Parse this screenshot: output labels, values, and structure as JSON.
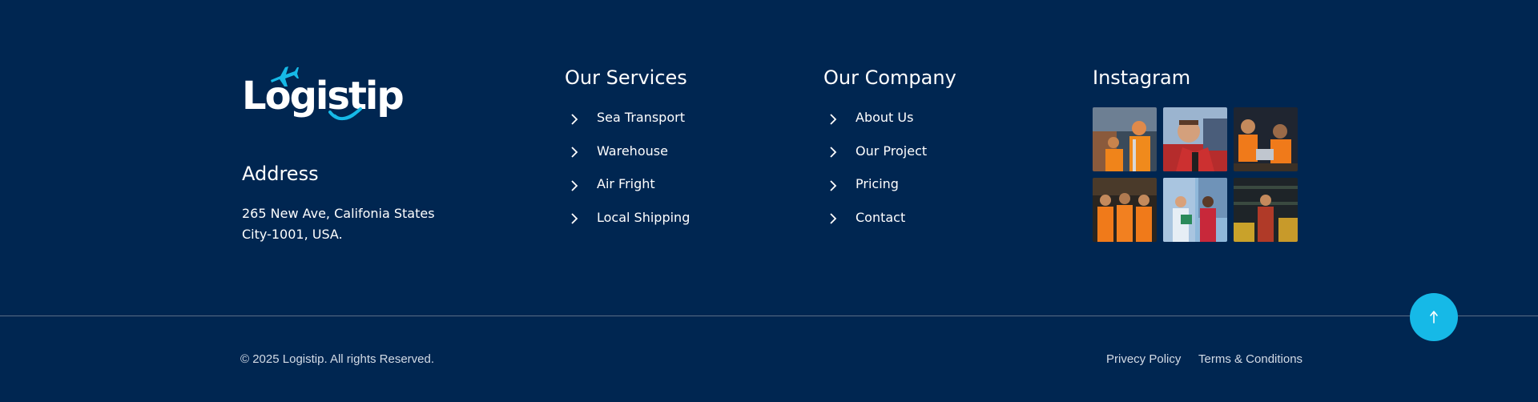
{
  "brand": {
    "name": "Logistip",
    "accent": "#16b9e7",
    "background": "#002651"
  },
  "address": {
    "title": "Address",
    "line1": "265 New Ave, Califonia States",
    "line2": "City-1001, USA."
  },
  "services": {
    "title": "Our Services",
    "items": [
      {
        "label": "Sea Transport"
      },
      {
        "label": "Warehouse"
      },
      {
        "label": "Air Fright"
      },
      {
        "label": "Local Shipping"
      }
    ]
  },
  "company": {
    "title": "Our Company",
    "items": [
      {
        "label": "About Us"
      },
      {
        "label": "Our Project"
      },
      {
        "label": "Pricing"
      },
      {
        "label": "Contact"
      }
    ]
  },
  "instagram": {
    "title": "Instagram",
    "images": [
      {
        "subject": "dock-workers-orange-vests"
      },
      {
        "subject": "smiling-worker-red-jacket"
      },
      {
        "subject": "workers-reviewing-laptop"
      },
      {
        "subject": "warehouse-team-orange-vests"
      },
      {
        "subject": "workers-with-tablet-containers"
      },
      {
        "subject": "worker-in-warehouse"
      }
    ]
  },
  "icons": {
    "chevron": "chevron-right-icon",
    "scroll_top": "arrow-up-icon"
  },
  "bottom": {
    "copyright": "© 2025 Logistip. All rights Reserved.",
    "privacy": "Privecy Policy",
    "terms": "Terms & Conditions"
  }
}
